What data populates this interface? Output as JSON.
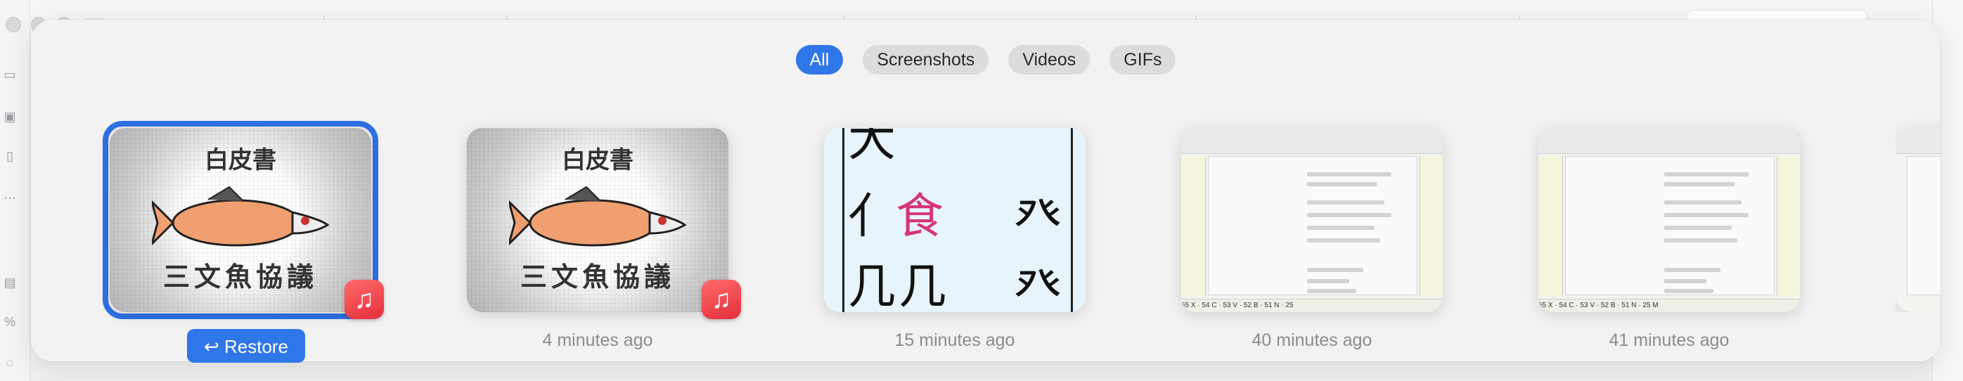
{
  "filters": {
    "all": "All",
    "screenshots": "Screenshots",
    "videos": "Videos",
    "gifs": "GIFs"
  },
  "items": [
    {
      "thumb_title": "白皮書",
      "thumb_subtitle": "三文魚協議",
      "badge_icon": "music-note-icon",
      "action_label": "↩ Restore"
    },
    {
      "thumb_title": "白皮書",
      "thumb_subtitle": "三文魚協議",
      "badge_icon": "music-note-icon",
      "caption": "4 minutes ago"
    },
    {
      "caption": "15 minutes ago"
    },
    {
      "caption": "40 minutes ago"
    },
    {
      "caption": "41 minutes ago"
    }
  ],
  "colors": {
    "accent": "#2f76e8",
    "selection_ring": "#2f72e6",
    "badge": "#e42f3b"
  }
}
